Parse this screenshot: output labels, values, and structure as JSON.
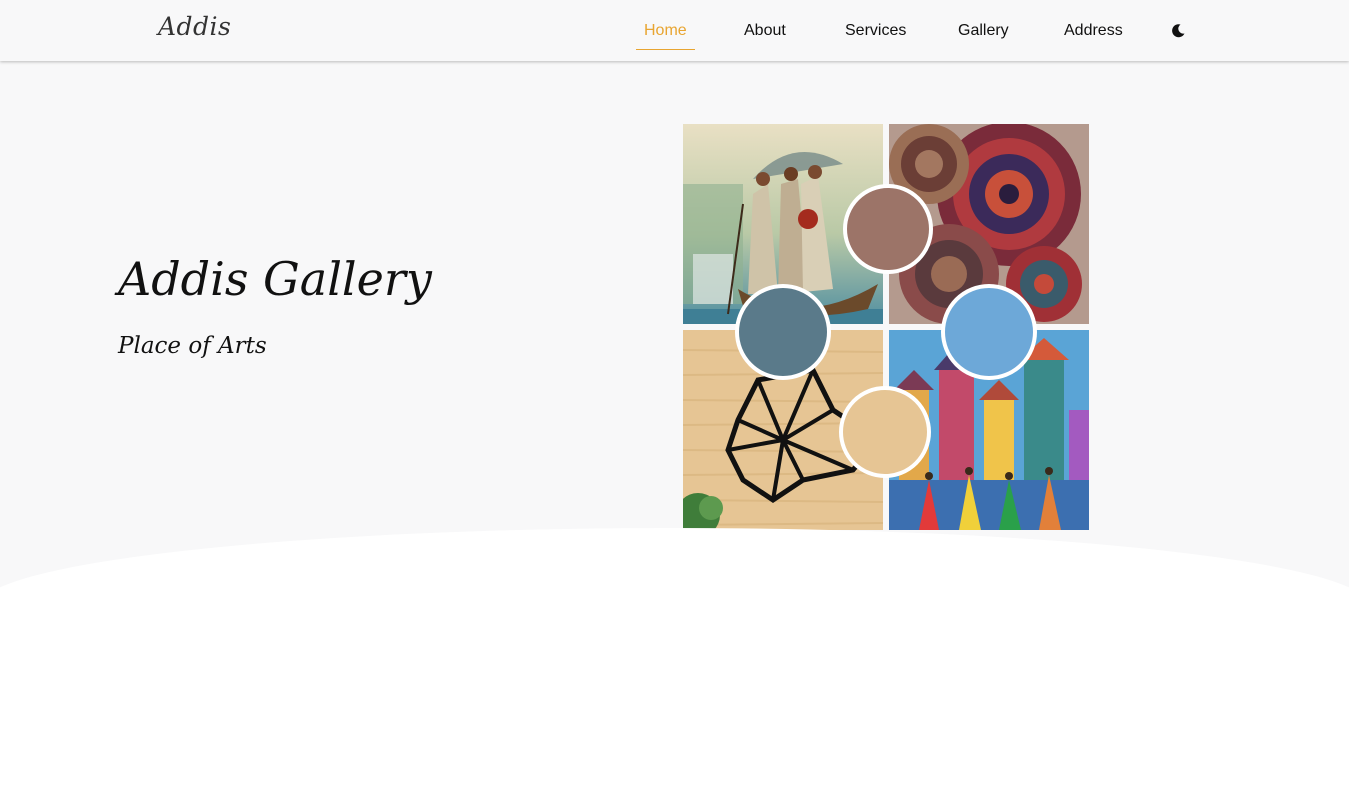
{
  "nav": {
    "logo": "Addis",
    "links": [
      {
        "label": "Home",
        "active": true
      },
      {
        "label": "About",
        "active": false
      },
      {
        "label": "Services",
        "active": false
      },
      {
        "label": "Gallery",
        "active": false
      },
      {
        "label": "Address",
        "active": false
      }
    ],
    "theme_toggle_icon": "moon-icon"
  },
  "hero": {
    "title": "Addis Gallery",
    "subtitle": "Place of Arts"
  },
  "colors": {
    "accent": "#e8a531",
    "background": "#f8f8f9",
    "text": "#111111"
  }
}
